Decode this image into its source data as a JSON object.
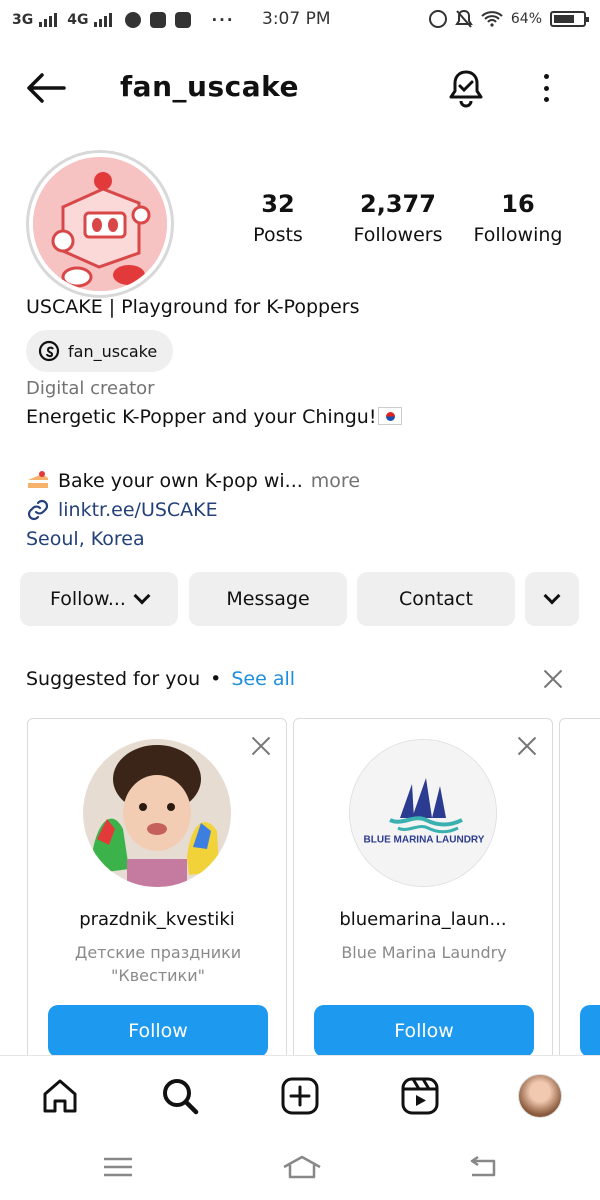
{
  "status_bar": {
    "network1": "3G",
    "network2": "4G",
    "dots": "···",
    "time": "3:07 PM",
    "battery": "64%"
  },
  "header": {
    "username": "fan_uscake"
  },
  "profile": {
    "stats": [
      {
        "value": "32",
        "label": "Posts"
      },
      {
        "value": "2,377",
        "label": "Followers"
      },
      {
        "value": "16",
        "label": "Following"
      }
    ],
    "bio_title": "USCAKE | Playground for K-Poppers",
    "threads_handle": "fan_uscake",
    "category": "Digital creator",
    "bio_line1": "Energetic K-Popper and your Chingu!",
    "bio_line2": "Bake your own K-pop wi...",
    "bio_more": "more",
    "link": "linktr.ee/USCAKE",
    "location": "Seoul, Korea"
  },
  "actions": {
    "follow": "Follow...",
    "message": "Message",
    "contact": "Contact"
  },
  "suggested": {
    "title": "Suggested for you",
    "separator": "•",
    "see_all": "See all",
    "cards": [
      {
        "name": "prazdnik_kvestiki",
        "sub": "Детские праздники \"Квестики\"",
        "button": "Follow"
      },
      {
        "name": "bluemarina_laun...",
        "sub": "Blue Marina Laundry",
        "logo_text": "BLUE MARINA LAUNDRY",
        "button": "Follow"
      }
    ]
  },
  "colors": {
    "accent": "#1d99f0",
    "link": "#24417a",
    "muted": "#737373"
  }
}
